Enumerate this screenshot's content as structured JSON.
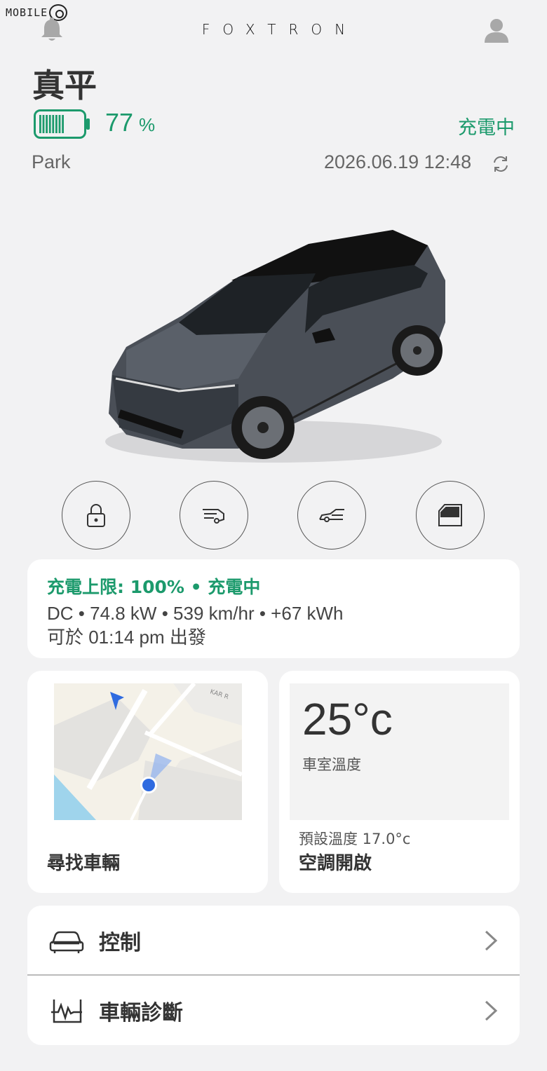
{
  "watermark": {
    "text": "MOBILE"
  },
  "header": {
    "brand": "FOXTRON"
  },
  "vehicle": {
    "name": "真平",
    "battery_percent": "77",
    "battery_unit": "%",
    "battery_level": 0.77,
    "charging_status": "充電中",
    "gear": "Park",
    "timestamp": "2026.06.19 12:48"
  },
  "quick_actions": [
    {
      "icon": "lock-icon"
    },
    {
      "icon": "trunk-icon"
    },
    {
      "icon": "frunk-icon"
    },
    {
      "icon": "window-icon"
    }
  ],
  "charge_card": {
    "line1": "充電上限: 100% • 充電中",
    "line2": "DC • 74.8 kW • 539 km/hr • +67 kWh",
    "line3": "可於 01:14 pm 出發"
  },
  "map_card": {
    "title": "尋找車輛",
    "street_label": "KAR R"
  },
  "climate_card": {
    "temperature": "25°c",
    "temperature_label": "車室溫度",
    "preset": "預設溫度 17.0°c",
    "status": "空調開啟"
  },
  "menu": [
    {
      "icon": "car-icon",
      "label": "控制"
    },
    {
      "icon": "diagnostics-icon",
      "label": "車輛診斷"
    }
  ],
  "colors": {
    "accent": "#1c9a6c",
    "background": "#f2f2f3",
    "card": "#ffffff"
  }
}
